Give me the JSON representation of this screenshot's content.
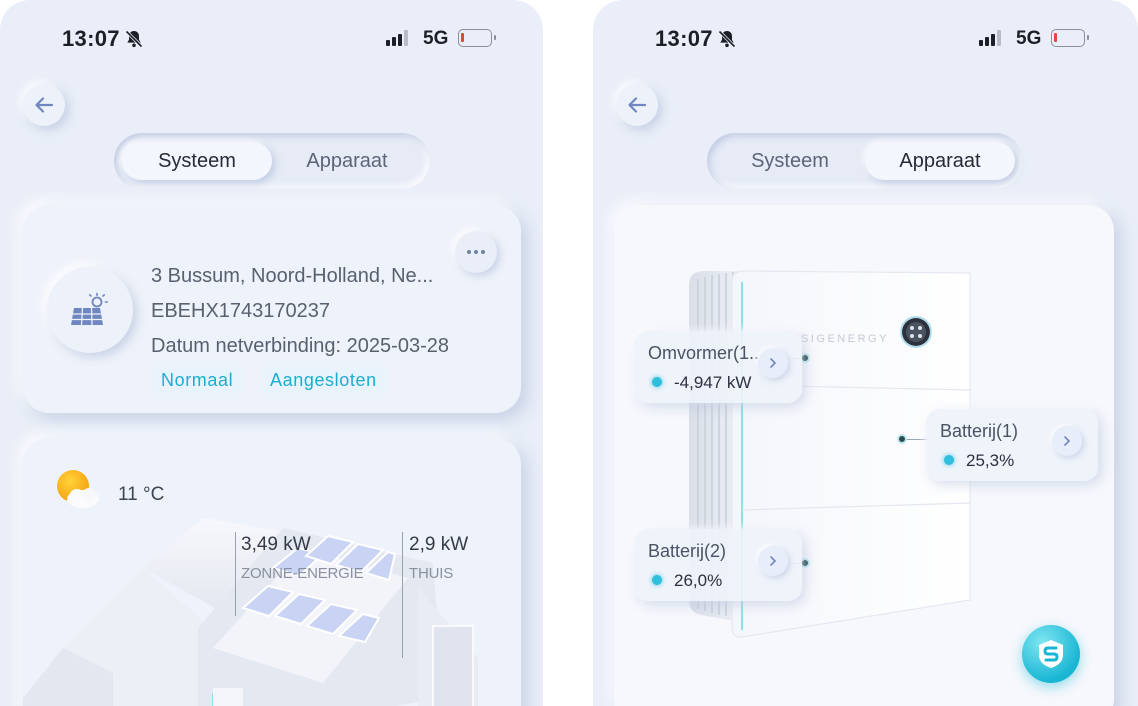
{
  "screens": [
    {
      "status": {
        "time": "13:07",
        "network": "5G"
      },
      "tabs": [
        {
          "label": "Systeem",
          "active": true
        },
        {
          "label": "Apparaat",
          "active": false
        }
      ],
      "site": {
        "address": "3 Bussum, Noord-Holland, Ne...",
        "serial": "EBEHX1743170237",
        "grid_connection": "Datum netverbinding: 2025-03-28",
        "tags": [
          "Normaal",
          "Aangesloten"
        ]
      },
      "weather": {
        "icon": "partly-cloudy-icon",
        "temperature": "11 °C"
      },
      "flows": [
        {
          "value": "3,49 kW",
          "label": "ZONNE-ENERGIE"
        },
        {
          "value": "2,9 kW",
          "label": "THUIS"
        }
      ]
    },
    {
      "status": {
        "time": "13:07",
        "network": "5G"
      },
      "tabs": [
        {
          "label": "Systeem",
          "active": false
        },
        {
          "label": "Apparaat",
          "active": true
        }
      ],
      "device": {
        "brand_text": "SIGENERGY",
        "components": [
          {
            "name": "Omvormer(1...",
            "reading": "-4,947 kW"
          },
          {
            "name": "Batterij(1)",
            "reading": "25,3%"
          },
          {
            "name": "Batterij(2)",
            "reading": "26,0%"
          }
        ]
      }
    }
  ],
  "colors": {
    "accent": "#1aaed2",
    "background": "#e9eef8",
    "battery_low": "#e2463d"
  }
}
